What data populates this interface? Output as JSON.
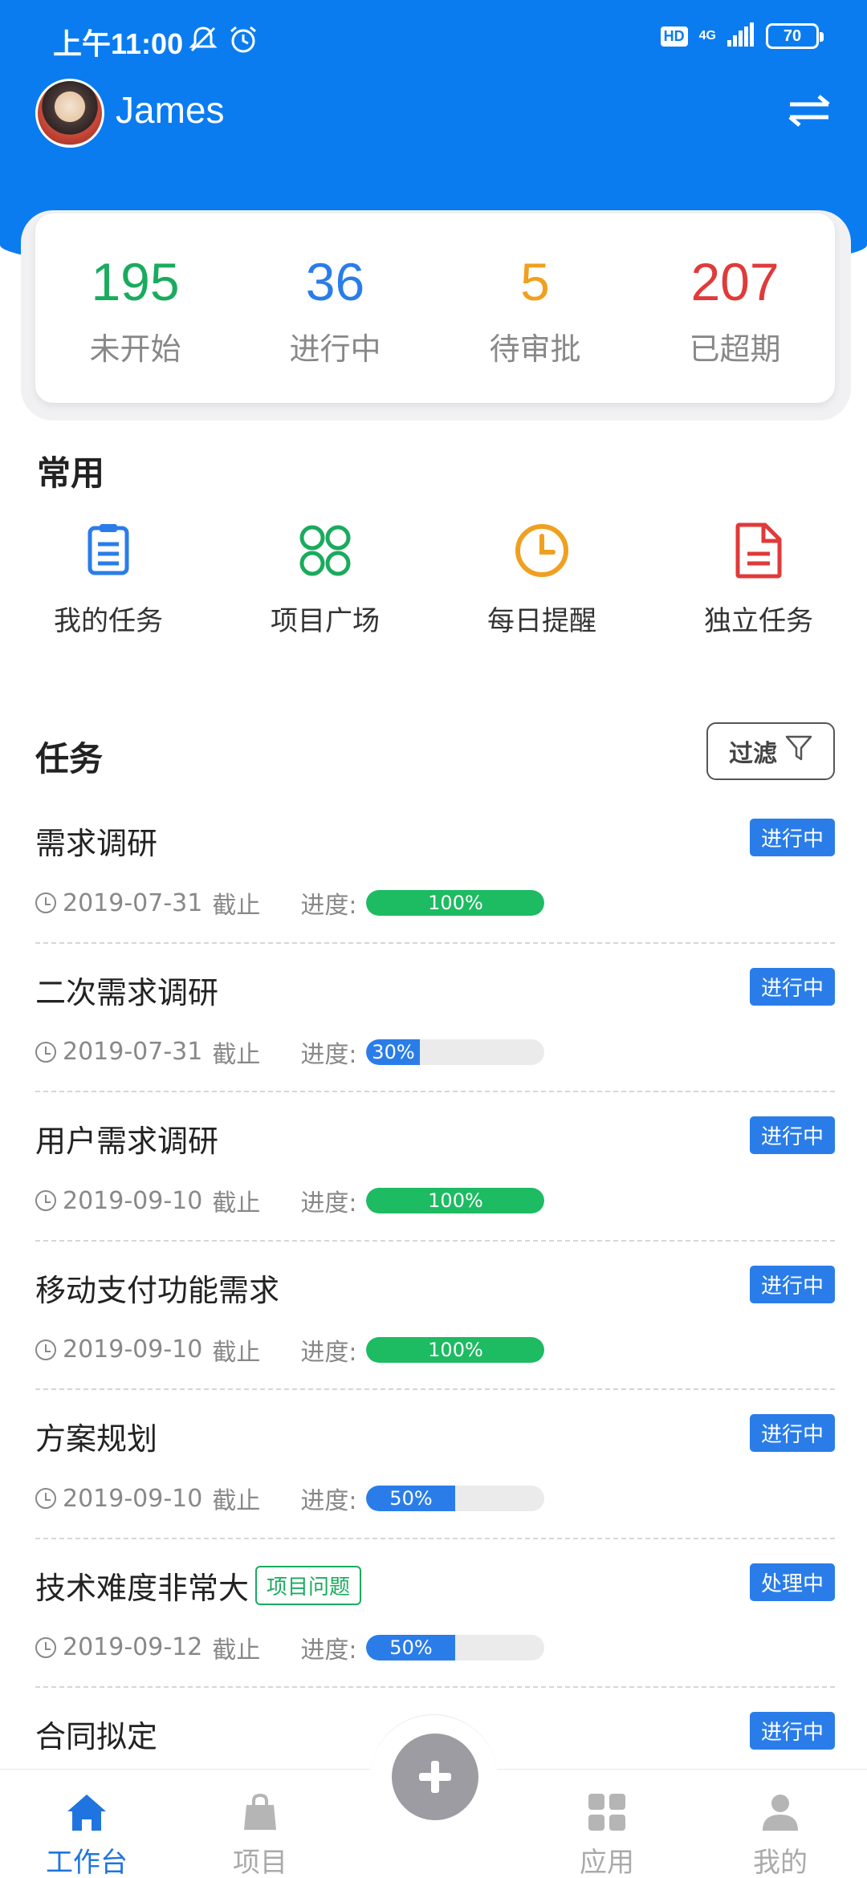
{
  "status_bar": {
    "time": "上午11:00",
    "hd": "HD",
    "network": "4G",
    "battery": "70"
  },
  "header": {
    "user_name": "James"
  },
  "stats": [
    {
      "value": "195",
      "label": "未开始",
      "color": "#1aab5e"
    },
    {
      "value": "36",
      "label": "进行中",
      "color": "#2a7de8"
    },
    {
      "value": "5",
      "label": "待审批",
      "color": "#f0a020"
    },
    {
      "value": "207",
      "label": "已超期",
      "color": "#e03a3a"
    }
  ],
  "common": {
    "title": "常用",
    "items": [
      {
        "label": "我的任务",
        "icon": "clipboard-icon",
        "color": "#2a7de8"
      },
      {
        "label": "项目广场",
        "icon": "grid-circles-icon",
        "color": "#1aab5e"
      },
      {
        "label": "每日提醒",
        "icon": "clock-icon",
        "color": "#f0a020"
      },
      {
        "label": "独立任务",
        "icon": "document-icon",
        "color": "#e03a3a"
      }
    ]
  },
  "tasks": {
    "title": "任务",
    "filter_label": "过滤",
    "progress_label": "进度:",
    "deadline_suffix": "截止",
    "items": [
      {
        "title": "需求调研",
        "tag": "",
        "status": "进行中",
        "date": "2019-07-31",
        "progress": 100,
        "progress_text": "100%",
        "color": "#1dbb62"
      },
      {
        "title": "二次需求调研",
        "tag": "",
        "status": "进行中",
        "date": "2019-07-31",
        "progress": 30,
        "progress_text": "30%",
        "color": "#2a7de8"
      },
      {
        "title": "用户需求调研",
        "tag": "",
        "status": "进行中",
        "date": "2019-09-10",
        "progress": 100,
        "progress_text": "100%",
        "color": "#1dbb62"
      },
      {
        "title": "移动支付功能需求",
        "tag": "",
        "status": "进行中",
        "date": "2019-09-10",
        "progress": 100,
        "progress_text": "100%",
        "color": "#1dbb62"
      },
      {
        "title": "方案规划",
        "tag": "",
        "status": "进行中",
        "date": "2019-09-10",
        "progress": 50,
        "progress_text": "50%",
        "color": "#2a7de8"
      },
      {
        "title": "技术难度非常大",
        "tag": "项目问题",
        "status": "处理中",
        "date": "2019-09-12",
        "progress": 50,
        "progress_text": "50%",
        "color": "#2a7de8"
      },
      {
        "title": "合同拟定",
        "tag": "",
        "status": "进行中",
        "date": "",
        "progress": null,
        "progress_text": "",
        "color": "#2a7de8"
      }
    ]
  },
  "bottom_nav": [
    {
      "label": "工作台",
      "icon": "home-icon",
      "active": true
    },
    {
      "label": "项目",
      "icon": "bag-icon",
      "active": false
    },
    {
      "label": "",
      "icon": "plus-icon",
      "active": false
    },
    {
      "label": "应用",
      "icon": "apps-icon",
      "active": false
    },
    {
      "label": "我的",
      "icon": "person-icon",
      "active": false
    }
  ]
}
